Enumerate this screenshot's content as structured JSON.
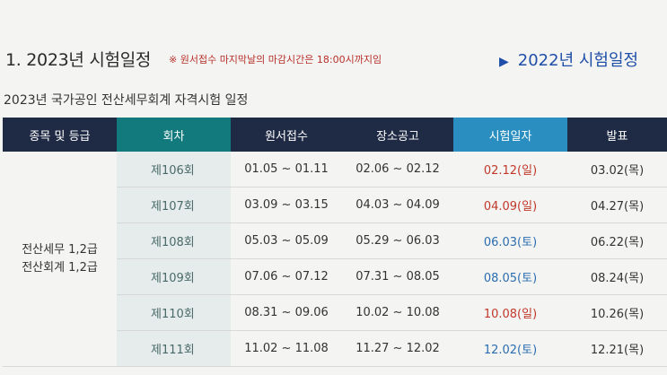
{
  "header": {
    "title": "1. 2023년 시험일정",
    "notice": "※ 원서접수 마지막날의 마감시간은 18:00시까지임",
    "prev_year_link": "2022년 시험일정",
    "prev_year_arrow": "▶"
  },
  "subtitle": "2023년 국가공인 전산세무회계 자격시험 일정",
  "table": {
    "headers": [
      "종목 및 등급",
      "회차",
      "원서접수",
      "장소공고",
      "시험일자",
      "발표"
    ],
    "category_line1": "전산세무 1,2급",
    "category_line2": "전산회계 1,2급",
    "rows": [
      {
        "round": "제106회",
        "apply": "01.05 ~ 01.11",
        "venue": "02.06 ~ 02.12",
        "exam": "02.12(일)",
        "exam_color": "red",
        "result": "03.02(목)"
      },
      {
        "round": "제107회",
        "apply": "03.09 ~ 03.15",
        "venue": "04.03 ~ 04.09",
        "exam": "04.09(일)",
        "exam_color": "red",
        "result": "04.27(목)"
      },
      {
        "round": "제108회",
        "apply": "05.03 ~ 05.09",
        "venue": "05.29 ~ 06.03",
        "exam": "06.03(토)",
        "exam_color": "blue",
        "result": "06.22(목)"
      },
      {
        "round": "제109회",
        "apply": "07.06 ~ 07.12",
        "venue": "07.31 ~ 08.05",
        "exam": "08.05(토)",
        "exam_color": "blue",
        "result": "08.24(목)"
      },
      {
        "round": "제110회",
        "apply": "08.31 ~ 09.06",
        "venue": "10.02 ~ 10.08",
        "exam": "10.08(일)",
        "exam_color": "red",
        "result": "10.26(목)"
      },
      {
        "round": "제111회",
        "apply": "11.02 ~ 11.08",
        "venue": "11.27 ~ 12.02",
        "exam": "12.02(토)",
        "exam_color": "blue",
        "result": "12.21(목)"
      }
    ]
  },
  "colors": {
    "header_dark": "#1f2a44",
    "header_teal": "#127a7d",
    "header_light": "#2a8fc0",
    "sunday_red": "#c0392b",
    "saturday_blue": "#2a6db0",
    "link_blue": "#1f4fa8"
  }
}
